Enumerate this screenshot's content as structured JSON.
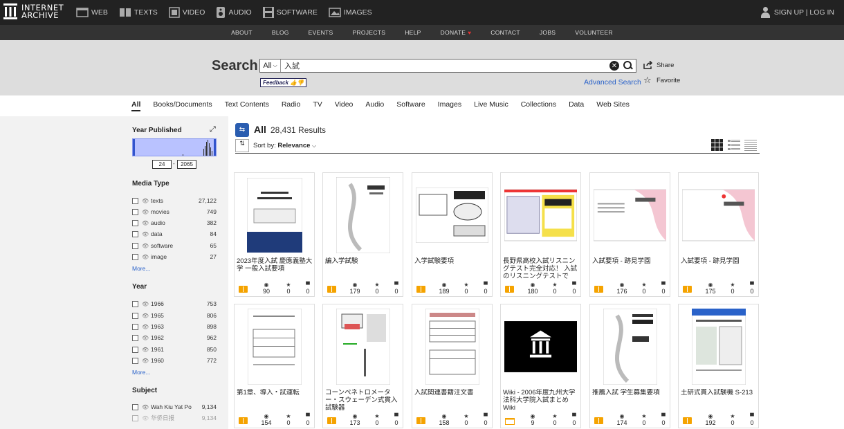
{
  "brand": {
    "line1": "INTERNET",
    "line2": "ARCHIVE"
  },
  "media_nav": [
    {
      "label": "WEB",
      "icon": "web-icon"
    },
    {
      "label": "TEXTS",
      "icon": "book-icon"
    },
    {
      "label": "VIDEO",
      "icon": "film-icon"
    },
    {
      "label": "AUDIO",
      "icon": "speaker-icon"
    },
    {
      "label": "SOFTWARE",
      "icon": "floppy-icon"
    },
    {
      "label": "IMAGES",
      "icon": "image-icon"
    }
  ],
  "account": {
    "label": "SIGN UP | LOG IN"
  },
  "subnav": [
    "ABOUT",
    "BLOG",
    "EVENTS",
    "PROJECTS",
    "HELP",
    "DONATE",
    "CONTACT",
    "JOBS",
    "VOLUNTEER"
  ],
  "search": {
    "title": "Search",
    "scope": "All",
    "query": "入試",
    "feedback": "Feedback",
    "advanced": "Advanced Search",
    "share": "Share",
    "favorite": "Favorite"
  },
  "tabs": [
    "All",
    "Books/Documents",
    "Text Contents",
    "Radio",
    "TV",
    "Video",
    "Audio",
    "Software",
    "Images",
    "Live Music",
    "Collections",
    "Data",
    "Web Sites"
  ],
  "sidebar": {
    "year_published": {
      "title": "Year Published",
      "from": "24",
      "to": "2065"
    },
    "media_type": {
      "title": "Media Type",
      "items": [
        {
          "name": "texts",
          "count": "27,122"
        },
        {
          "name": "movies",
          "count": "749"
        },
        {
          "name": "audio",
          "count": "382"
        },
        {
          "name": "data",
          "count": "84"
        },
        {
          "name": "software",
          "count": "65"
        },
        {
          "name": "image",
          "count": "27"
        }
      ],
      "more": "More..."
    },
    "year": {
      "title": "Year",
      "items": [
        {
          "name": "1966",
          "count": "753"
        },
        {
          "name": "1965",
          "count": "806"
        },
        {
          "name": "1963",
          "count": "898"
        },
        {
          "name": "1962",
          "count": "962"
        },
        {
          "name": "1961",
          "count": "850"
        },
        {
          "name": "1960",
          "count": "772"
        }
      ],
      "more": "More..."
    },
    "subject": {
      "title": "Subject",
      "items": [
        {
          "name": "Wah Kiu Yat Po",
          "count": "9,134"
        },
        {
          "name": "华侨日报",
          "count": "9,134"
        }
      ]
    }
  },
  "results": {
    "all_label": "All",
    "count": "28,431 Results",
    "sort_label": "Sort by:",
    "sort_value": "Relevance"
  },
  "cards": [
    {
      "title": "2023年度入試 慶應義塾大学 一般入試要項",
      "views": "90",
      "favs": "0",
      "reviews": "0",
      "type": "texts"
    },
    {
      "title": "編入学試験",
      "views": "179",
      "favs": "0",
      "reviews": "0",
      "type": "texts"
    },
    {
      "title": "入学試験要項",
      "views": "189",
      "favs": "0",
      "reviews": "0",
      "type": "texts"
    },
    {
      "title": "長野県高校入試リスニングテスト完全対応！ 入試のリスニングテストで",
      "views": "180",
      "favs": "0",
      "reviews": "0",
      "type": "texts"
    },
    {
      "title": "入試要項 - 跡見学園",
      "views": "176",
      "favs": "0",
      "reviews": "0",
      "type": "texts"
    },
    {
      "title": "入試要項 - 跡見学園",
      "views": "175",
      "favs": "0",
      "reviews": "0",
      "type": "texts"
    },
    {
      "title": "第1章、導入・試運転",
      "views": "154",
      "favs": "0",
      "reviews": "0",
      "type": "texts"
    },
    {
      "title": "コーンペネトロメーター・スウェーデン式貫入試験器",
      "views": "173",
      "favs": "0",
      "reviews": "0",
      "type": "texts"
    },
    {
      "title": "入試関連書籍注文書",
      "views": "158",
      "favs": "0",
      "reviews": "0",
      "type": "texts"
    },
    {
      "title": "Wiki - 2006年度九州大学法科大学院入試まとめWiki",
      "views": "9",
      "favs": "0",
      "reviews": "0",
      "type": "web"
    },
    {
      "title": "推薦入試 学生募集要項",
      "views": "174",
      "favs": "0",
      "reviews": "0",
      "type": "texts"
    },
    {
      "title": "土研式貫入試験機 S-213",
      "views": "192",
      "favs": "0",
      "reviews": "0",
      "type": "texts"
    }
  ],
  "colors": {
    "accent": "#2a62c9",
    "topbar": "#222222",
    "histogram": "#b9c2ff"
  }
}
